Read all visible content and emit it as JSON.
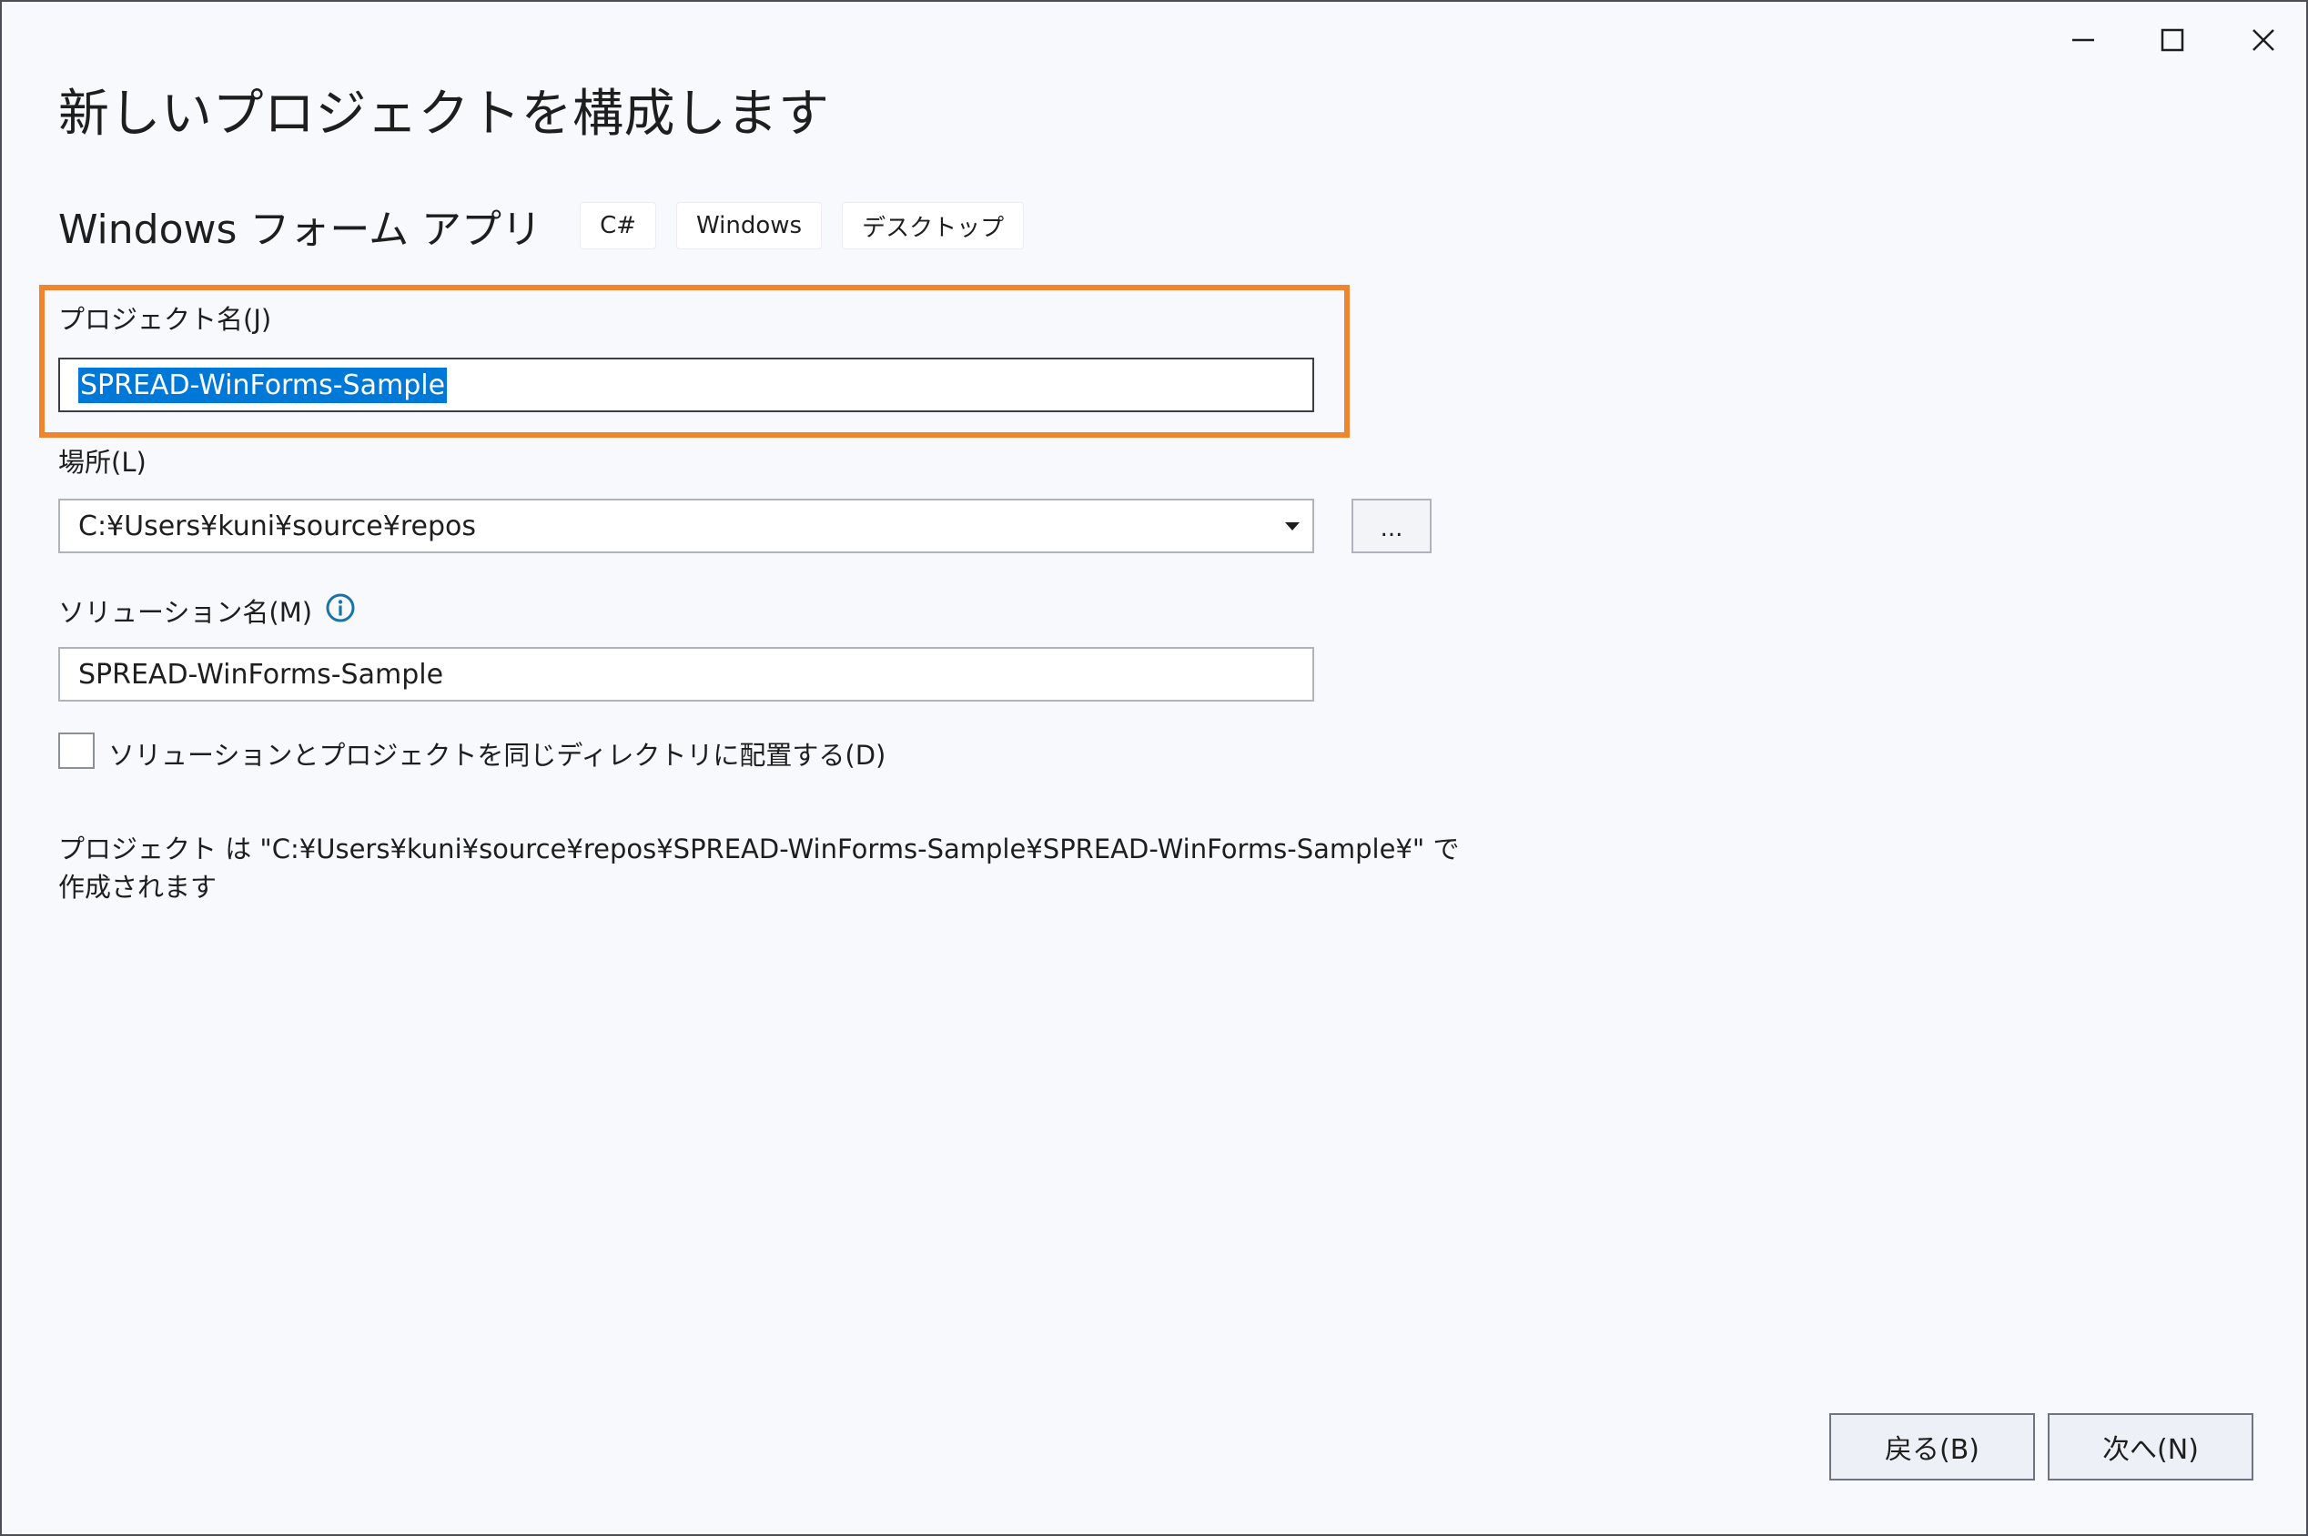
{
  "window": {
    "controls": {
      "minimize_icon": "minimize-icon",
      "maximize_icon": "maximize-icon",
      "close_icon": "close-icon"
    }
  },
  "header": {
    "title": "新しいプロジェクトを構成します"
  },
  "template": {
    "name": "Windows フォーム アプリ",
    "tags": [
      "C#",
      "Windows",
      "デスクトップ"
    ]
  },
  "project_name": {
    "label": "プロジェクト名(J)",
    "value": "SPREAD-WinForms-Sample"
  },
  "location": {
    "label": "場所(L)",
    "value": "C:¥Users¥kuni¥source¥repos",
    "browse_label": "..."
  },
  "solution_name": {
    "label": "ソリューション名(M)",
    "value": "SPREAD-WinForms-Sample",
    "info_icon": "info-icon"
  },
  "same_directory": {
    "label": "ソリューションとプロジェクトを同じディレクトリに配置する(D)",
    "checked": false
  },
  "summary": {
    "line1": "プロジェクト は \"C:¥Users¥kuni¥source¥repos¥SPREAD-WinForms-Sample¥SPREAD-WinForms-Sample¥\" で",
    "line2": "作成されます"
  },
  "footer": {
    "back_label": "戻る(B)",
    "next_label": "次へ(N)"
  },
  "colors": {
    "highlight": "#f0852d",
    "selection": "#0078d7",
    "info": "#1a73a8"
  }
}
